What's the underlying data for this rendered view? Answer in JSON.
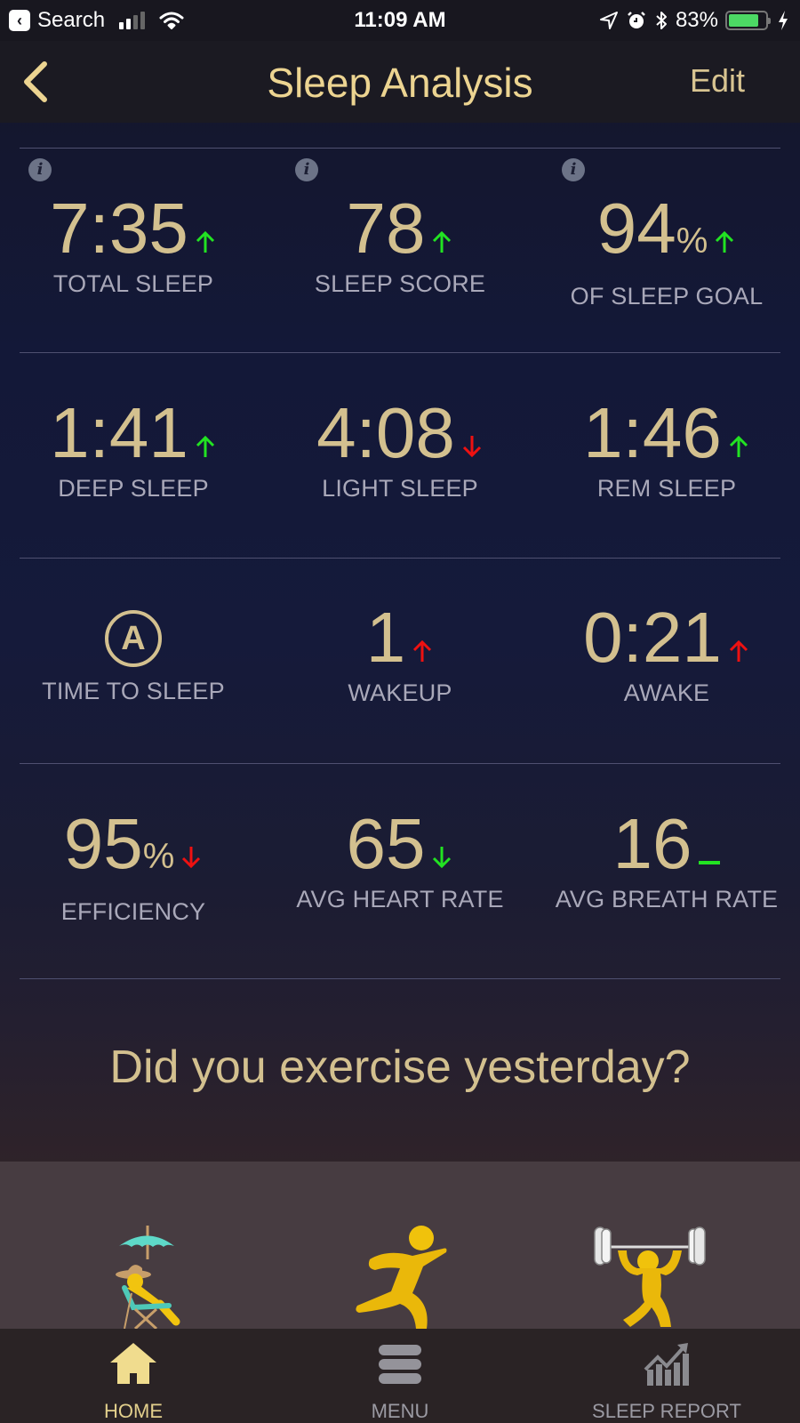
{
  "status_bar": {
    "back_app": "Search",
    "time": "11:09 AM",
    "battery_percent": "83%",
    "battery_level": 0.83,
    "signal_bars_active": 2,
    "signal_bars_total": 4,
    "icons": [
      "back-to-app-icon",
      "cellular-signal-icon",
      "wifi-icon",
      "location-icon",
      "alarm-icon",
      "bluetooth-icon",
      "battery-icon",
      "charging-icon"
    ]
  },
  "nav": {
    "title": "Sleep Analysis",
    "back_icon": "chevron-left-icon",
    "edit_label": "Edit"
  },
  "colors": {
    "accent": "#d3c08f",
    "title": "#ecd491",
    "label": "#a9a8b9",
    "trend_good": "#22e322",
    "trend_bad": "#ee1111"
  },
  "metrics": [
    {
      "key": "total_sleep",
      "value": "7:35",
      "unit": "",
      "label": "TOTAL SLEEP",
      "trend": "up",
      "trend_color": "good",
      "info": true
    },
    {
      "key": "sleep_score",
      "value": "78",
      "unit": "",
      "label": "SLEEP SCORE",
      "trend": "up",
      "trend_color": "good",
      "info": true
    },
    {
      "key": "sleep_goal",
      "value": "94",
      "unit": "%",
      "label": "OF SLEEP GOAL",
      "trend": "up",
      "trend_color": "good",
      "info": true
    },
    {
      "key": "deep_sleep",
      "value": "1:41",
      "unit": "",
      "label": "DEEP SLEEP",
      "trend": "up",
      "trend_color": "good",
      "info": false
    },
    {
      "key": "light_sleep",
      "value": "4:08",
      "unit": "",
      "label": "LIGHT SLEEP",
      "trend": "down",
      "trend_color": "bad",
      "info": false
    },
    {
      "key": "rem_sleep",
      "value": "1:46",
      "unit": "",
      "label": "REM SLEEP",
      "trend": "up",
      "trend_color": "good",
      "info": false
    },
    {
      "key": "time_to_sleep",
      "value": "A",
      "unit": "",
      "label": "TIME TO SLEEP",
      "trend": "none",
      "trend_color": "",
      "info": false,
      "icon": "auto-icon"
    },
    {
      "key": "wakeup",
      "value": "1",
      "unit": "",
      "label": "WAKEUP",
      "trend": "up",
      "trend_color": "bad",
      "info": false
    },
    {
      "key": "awake",
      "value": "0:21",
      "unit": "",
      "label": "AWAKE",
      "trend": "up",
      "trend_color": "bad",
      "info": false
    },
    {
      "key": "efficiency",
      "value": "95",
      "unit": "%",
      "label": "EFFICIENCY",
      "trend": "down",
      "trend_color": "bad",
      "info": false
    },
    {
      "key": "avg_heart_rate",
      "value": "65",
      "unit": "",
      "label": "AVG HEART RATE",
      "trend": "down",
      "trend_color": "good",
      "info": false
    },
    {
      "key": "avg_breath_rate",
      "value": "16",
      "unit": "",
      "label": "AVG BREATH RATE",
      "trend": "flat",
      "trend_color": "good",
      "info": false
    }
  ],
  "exercise": {
    "question": "Did you exercise yesterday?",
    "options": [
      {
        "name": "relaxing",
        "icon": "beach-chair-relax-icon"
      },
      {
        "name": "running",
        "icon": "running-person-icon"
      },
      {
        "name": "weightlifting",
        "icon": "weightlifter-icon"
      }
    ]
  },
  "tabs": [
    {
      "label": "HOME",
      "icon": "home-icon",
      "active": true
    },
    {
      "label": "MENU",
      "icon": "hamburger-menu-icon",
      "active": false
    },
    {
      "label": "SLEEP REPORT",
      "icon": "chart-report-icon",
      "active": false
    }
  ]
}
